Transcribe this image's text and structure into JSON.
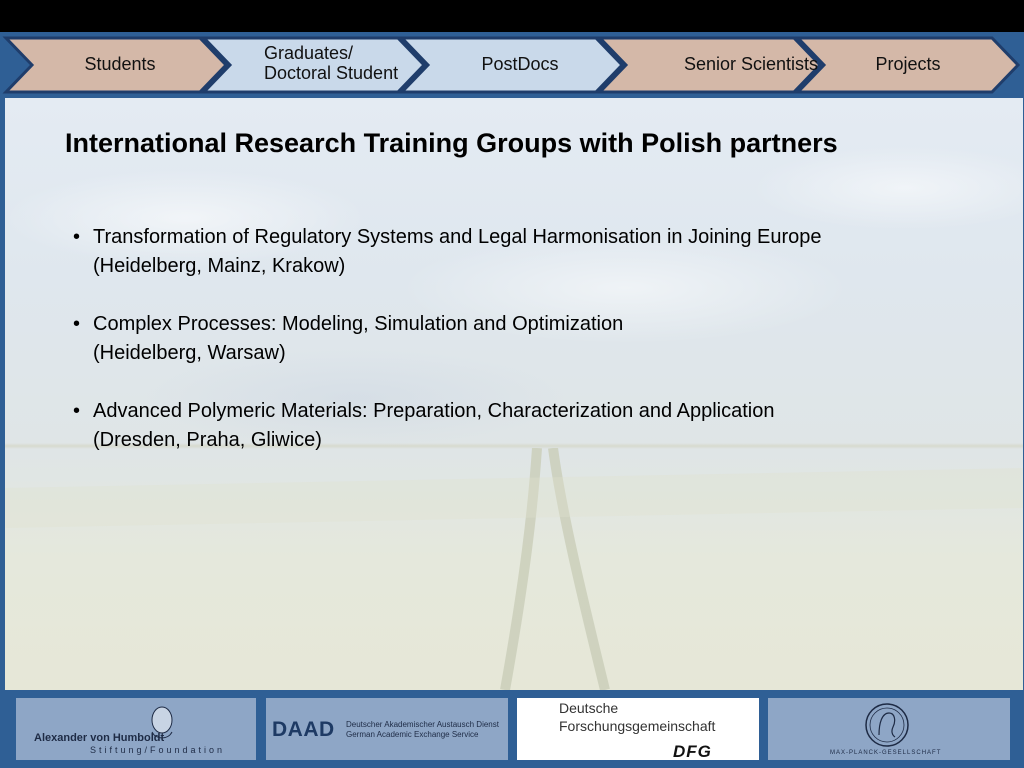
{
  "nav": {
    "tabs": [
      {
        "label": "Students"
      },
      {
        "label_line1": "Graduates/",
        "label_line2": "Doctoral Student"
      },
      {
        "label": "PostDocs"
      },
      {
        "label": "Senior Scientists"
      },
      {
        "label": "Projects"
      }
    ]
  },
  "main": {
    "title": "International Research Training Groups with Polish partners",
    "items": [
      {
        "text": "Transformation of Regulatory Systems and Legal Harmonisation in Joining Europe",
        "cities": "(Heidelberg, Mainz, Krakow)"
      },
      {
        "text": "Complex Processes: Modeling, Simulation and Optimization",
        "cities": "(Heidelberg, Warsaw)"
      },
      {
        "text": "Advanced Polymeric Materials: Preparation, Characterization and Application",
        "cities": "(Dresden, Praha, Gliwice)"
      }
    ]
  },
  "footer": {
    "humboldt": {
      "name": "Alexander von Humboldt",
      "sub": "Stiftung/Foundation"
    },
    "daad": {
      "mark": "DAAD",
      "line1": "Deutscher Akademischer Austausch Dienst",
      "line2": "German Academic Exchange Service"
    },
    "dfg": {
      "line1": "Deutsche",
      "line2": "Forschungsgemeinschaft",
      "mark": "DFG"
    },
    "mpg": {
      "text": "MAX-PLANCK-GESELLSCHAFT"
    }
  },
  "colors": {
    "frame": "#2f5f95",
    "tab_tan": "#d4b8a8",
    "tab_blue": "#c9d9ea",
    "tab_border": "#1f3d6b",
    "logo_panel": "#8ea6c6"
  }
}
